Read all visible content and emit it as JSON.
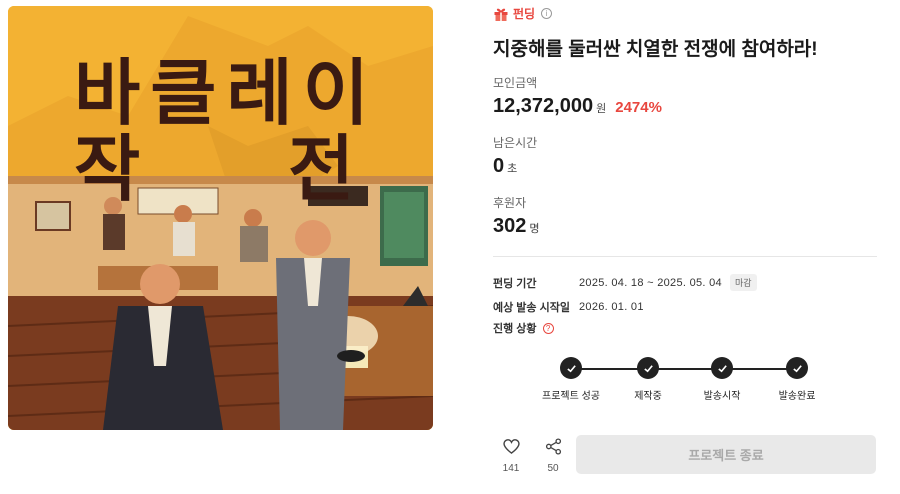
{
  "cover": {
    "title_line1": "바클레이",
    "title_line2_left": "작",
    "title_line2_right": "전"
  },
  "badge": {
    "icon": "gift-icon",
    "label": "펀딩",
    "info_icon": "info-icon"
  },
  "project": {
    "title": "지중해를 둘러싼 치열한 전쟁에 참여하라!"
  },
  "stats": {
    "raised": {
      "label": "모인금액",
      "value": "12,372,000",
      "unit": "원",
      "rate": "2474%"
    },
    "remaining": {
      "label": "남은시간",
      "value": "0",
      "unit": "초"
    },
    "backers": {
      "label": "후원자",
      "value": "302",
      "unit": "명"
    }
  },
  "details": {
    "period": {
      "key": "펀딩 기간",
      "value": "2025. 04. 18 ~ 2025. 05. 04",
      "tag": "마감"
    },
    "shipping": {
      "key": "예상 발송 시작일",
      "value": "2026. 01. 01"
    },
    "status": {
      "key": "진행 상황",
      "icon": "help-icon"
    }
  },
  "progress_steps": [
    {
      "label": "프로젝트 성공",
      "done": true
    },
    {
      "label": "제작중",
      "done": true
    },
    {
      "label": "발송시작",
      "done": true
    },
    {
      "label": "발송완료",
      "done": true
    }
  ],
  "actions": {
    "like": {
      "icon": "heart-icon",
      "count": "141"
    },
    "share": {
      "icon": "share-icon",
      "count": "50"
    },
    "end_button": "프로젝트 종료"
  },
  "colors": {
    "accent": "#e8473f",
    "cover_bg": "#f3b233",
    "step": "#222222"
  }
}
